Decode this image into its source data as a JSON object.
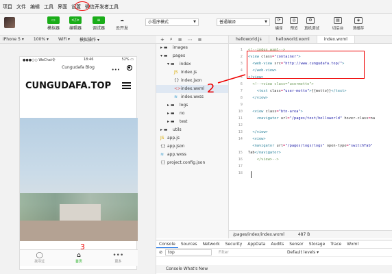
{
  "menu": [
    "项目",
    "文件",
    "编辑",
    "工具",
    "界面",
    "设置",
    "微信开发者工具"
  ],
  "toolbar": {
    "buttons": [
      {
        "label": "模拟器",
        "glyph": "▭"
      },
      {
        "label": "编辑器",
        "glyph": "</>"
      },
      {
        "label": "调试器",
        "glyph": "≡"
      },
      {
        "label": "云开发",
        "glyph": "☁"
      }
    ],
    "mode_select": "小程序模式",
    "compile_select": "普通编译",
    "actions": [
      {
        "label": "编译",
        "glyph": "⟳"
      },
      {
        "label": "预览",
        "glyph": "◎"
      },
      {
        "label": "真机调试",
        "glyph": "⚙"
      },
      {
        "label": "切后台",
        "glyph": "▤"
      },
      {
        "label": "清缓存",
        "glyph": "◈"
      }
    ]
  },
  "device_bar": [
    "iPhone 5 ▾",
    "100% ▾",
    "WiFi ▾",
    "模拟操作 ▾"
  ],
  "phone": {
    "status_left": "●●●○○ WeChat令",
    "status_time": "18:46",
    "status_right": "52% ▭",
    "nav_title": "Cungudafa Blog",
    "nav_dots": "•••",
    "brand_title": "CUNGUDAFA.TOP",
    "tabs": [
      {
        "label": "找寻过",
        "glyph": "◯"
      },
      {
        "label": "首页",
        "glyph": "⌂"
      },
      {
        "label": "更多",
        "glyph": "•••"
      }
    ]
  },
  "tree": {
    "toolbar": [
      "+",
      "⌕",
      "≡",
      "⋯",
      "≡"
    ],
    "items": [
      {
        "label": "images",
        "kind": "folder",
        "indent": 0,
        "open": false
      },
      {
        "label": "pages",
        "kind": "folder",
        "indent": 0,
        "open": true
      },
      {
        "label": "index",
        "kind": "folder",
        "indent": 1,
        "open": true
      },
      {
        "label": "index.js",
        "kind": "js",
        "indent": 2
      },
      {
        "label": "index.json",
        "kind": "json",
        "indent": 2
      },
      {
        "label": "index.wxml",
        "kind": "wxml",
        "indent": 2,
        "selected": true
      },
      {
        "label": "index.wxss",
        "kind": "wxss",
        "indent": 2
      },
      {
        "label": "logs",
        "kind": "folder",
        "indent": 1,
        "open": false
      },
      {
        "label": "no",
        "kind": "folder",
        "indent": 1,
        "open": false
      },
      {
        "label": "test",
        "kind": "folder",
        "indent": 1,
        "open": false
      },
      {
        "label": "utils",
        "kind": "folder",
        "indent": 0,
        "open": false
      },
      {
        "label": "app.js",
        "kind": "js",
        "indent": 0
      },
      {
        "label": "app.json",
        "kind": "json",
        "indent": 0
      },
      {
        "label": "app.wxss",
        "kind": "wxss",
        "indent": 0
      },
      {
        "label": "project.config.json",
        "kind": "json",
        "indent": 0
      }
    ]
  },
  "editor": {
    "tabs": [
      "helloworld.js",
      "helloworld.wxml",
      "index.wxml"
    ],
    "active_tab": 2,
    "lines": [
      "<!--index.wxml-->",
      "<view class=\"container\">",
      "  <web-view src=\"http://www.cungudafa.top/\">",
      "  </web-view>",
      "</view>",
      "  <!--<view class=\"usermotto\">",
      "    <text class=\"user-motto\">{{motto}}</text>",
      "  </view>",
      "",
      "  <view class=\"btn-area\">",
      "    <navigator url=\"/pages/test/helloworld\" hover-class=\"na",
      "",
      "  </view>",
      "  <view>",
      "  <navigator url=\"/pages/logs/logs\" open-type=\"switchTab\"",
      "Tab</navigator>",
      "    </view>-->",
      "",
      "",
      ""
    ],
    "line_numbers": [
      "1",
      "2",
      "3",
      "4",
      "5",
      "6",
      "7",
      "8",
      "9",
      "10",
      "11",
      "12",
      "13",
      "14",
      "",
      "15",
      "16",
      "17",
      "18",
      ""
    ],
    "status_path": "/pages/index/index.wxml",
    "status_size": "487 B"
  },
  "annotations": {
    "arrow_label": "2",
    "bottom_label": "3"
  },
  "devtools": {
    "tabs": [
      "Console",
      "Sources",
      "Network",
      "Security",
      "AppData",
      "Audits",
      "Sensor",
      "Storage",
      "Trace",
      "Wxml"
    ],
    "active_tab": 0,
    "context": "top",
    "filter_placeholder": "Filter",
    "levels": "Default levels ▾",
    "bottom_tabs": "Console  What's New"
  },
  "colors": {
    "accent_green": "#1aad19",
    "annotation_red": "#e00000"
  }
}
